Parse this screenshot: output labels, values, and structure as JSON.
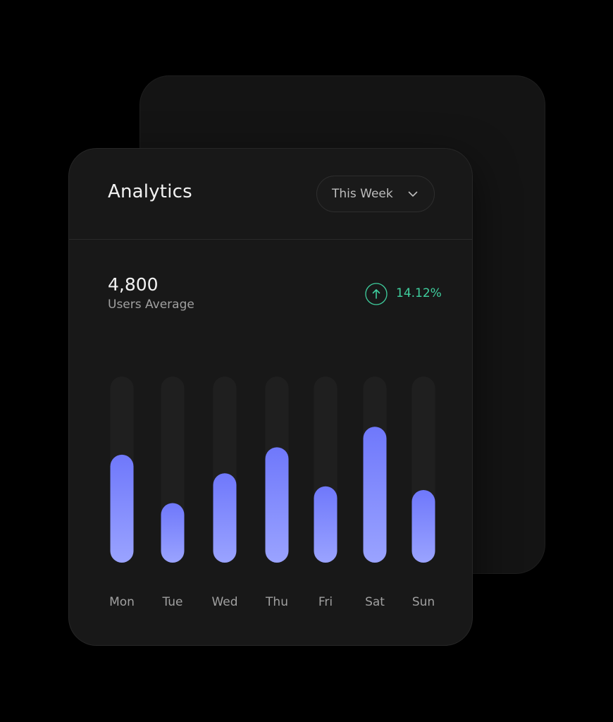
{
  "header": {
    "title": "Analytics",
    "period_select": {
      "selected": "This Week",
      "icon": "chevron-down-icon"
    }
  },
  "summary": {
    "value": "4,800",
    "label": "Users Average",
    "change": "14.12%",
    "change_icon": "arrow-up-icon"
  },
  "colors": {
    "background": "#000000",
    "card": "#181818",
    "track": "#1f1f1f",
    "bar_top": "#6f78fb",
    "bar_bottom": "#9aa3ff",
    "positive": "#3fcf9e",
    "text_primary": "#f2f2f2",
    "text_secondary": "#a0a0a0"
  },
  "chart_data": {
    "type": "bar",
    "categories": [
      "Mon",
      "Tue",
      "Wed",
      "Thu",
      "Fri",
      "Sat",
      "Sun"
    ],
    "values": [
      58,
      32,
      48,
      62,
      41,
      73,
      39
    ],
    "ylim": [
      0,
      100
    ],
    "grid": false,
    "xlabel": "",
    "ylabel": ""
  }
}
